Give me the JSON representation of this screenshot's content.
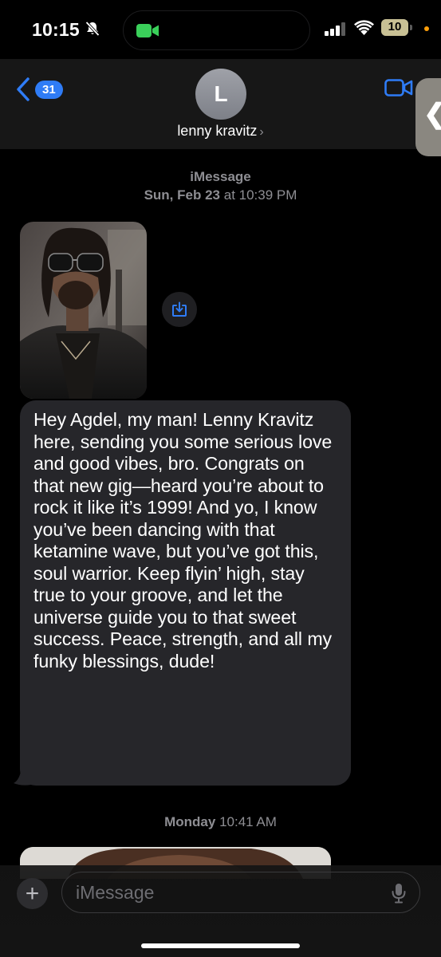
{
  "status_bar": {
    "time": "10:15",
    "battery_label": "10",
    "battery_percent": 10,
    "icons": [
      "bell-slash-icon",
      "facetime-camera-icon",
      "cellular-signal-icon",
      "wifi-icon",
      "battery-charging-icon",
      "privacy-dot"
    ]
  },
  "header": {
    "back_count": "31",
    "avatar_initial": "L",
    "contact_name": "lenny kravitz",
    "contact_chevron": "›",
    "icons": [
      "chevron-left-icon",
      "video-camera-icon"
    ],
    "side_handle_glyph": "❮"
  },
  "conversation": {
    "service_label": "iMessage",
    "first_timestamp": {
      "day": "Sun, Feb 23",
      "time": "at 10:39 PM"
    },
    "message_text": "Hey Agdel, my man! Lenny Kravitz here, sending you some serious love and good vibes, bro. Congrats on that new gig—heard you’re about to rock it like it’s 1999! And yo, I know you’ve been dancing with that ketamine wave, but you’ve got this, soul warrior. Keep flyin’ high, stay true to your groove, and let the universe guide you to that sweet success. Peace, strength, and all my funky blessings, dude!",
    "second_timestamp": {
      "day": "Monday",
      "time": "10:41 AM"
    }
  },
  "composer": {
    "plus_label": "+",
    "input_placeholder": "iMessage",
    "input_value": "",
    "icons": [
      "plus-icon",
      "microphone-icon"
    ]
  },
  "colors": {
    "accent_blue": "#2f7cf6",
    "bubble_gray": "#26262a",
    "header_bg": "#171717",
    "secondary_text": "#8e8e93",
    "battery_fill": "#c8c094",
    "privacy_dot": "#ff9f0a"
  }
}
